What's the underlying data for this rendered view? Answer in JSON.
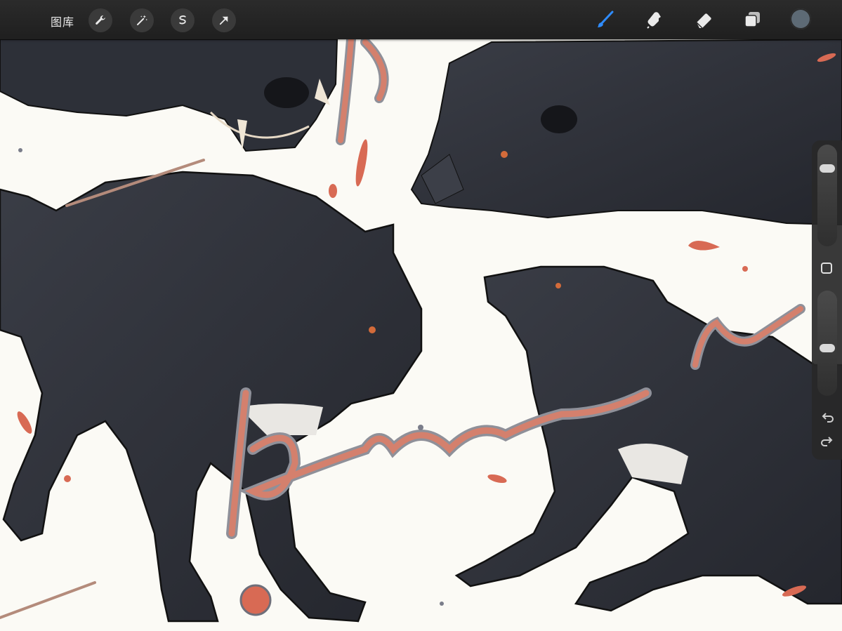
{
  "toolbar": {
    "gallery_label": "图库",
    "left_tools": [
      "wrench-icon",
      "magic-wand-icon",
      "selection-icon",
      "transform-arrow-icon"
    ],
    "right_tools": [
      "brush-icon",
      "smudge-icon",
      "eraser-icon",
      "layers-icon"
    ],
    "current_color": "#5d6a75",
    "brush_active_color": "#2f8cff"
  },
  "sidebar": {
    "brush_size_level": 0.8,
    "opacity_level": 0.45
  },
  "canvas": {
    "background": "#fbfaf5",
    "accent_color": "#d26a58"
  }
}
